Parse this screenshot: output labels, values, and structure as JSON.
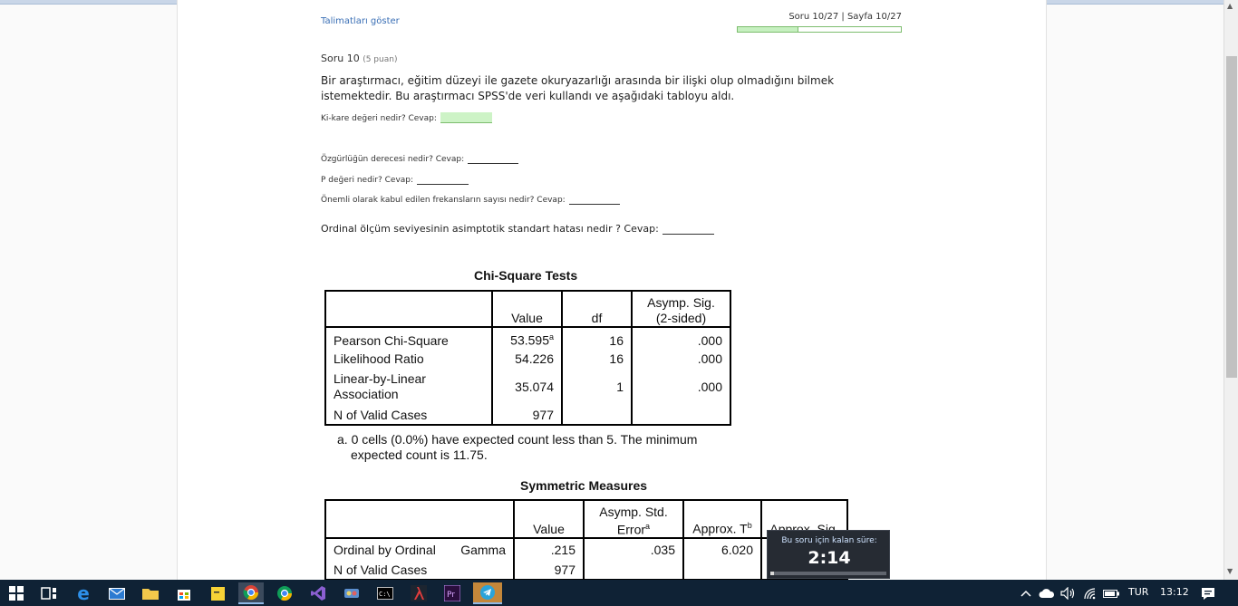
{
  "header": {
    "instructions_link": "Talimatları göster",
    "progress_label": "Soru 10/27 | Sayfa 10/27",
    "progress": 0.37
  },
  "question": {
    "title": "Soru 10",
    "points": "(5 puan)",
    "text": "Bir araştırmacı, eğitim düzeyi ile gazete okuryazarlığı arasında bir ilişki olup olmadığını bilmek istemektedir. Bu araştırmacı SPSS'de veri kullandı ve aşağıdaki tabloyu aldı.",
    "q1": "Ki-kare değeri nedir? Cevap:",
    "q2": "Özgürlüğün derecesi nedir? Cevap:",
    "q3": "P değeri nedir? Cevap:",
    "q4": "Önemli olarak kabul edilen frekansların sayısı nedir? Cevap:",
    "q5": "Ordinal ölçüm seviyesinin asimptotik standart hatası nedir ? Cevap:"
  },
  "chi_square_table": {
    "title": "Chi-Square Tests",
    "headers": [
      "",
      "Value",
      "df",
      "Asymp. Sig. (2-sided)"
    ],
    "rows": [
      {
        "label": "Pearson Chi-Square",
        "value": "53.595",
        "sup": "a",
        "df": "16",
        "sig": ".000"
      },
      {
        "label": "Likelihood Ratio",
        "value": "54.226",
        "sup": "",
        "df": "16",
        "sig": ".000"
      },
      {
        "label": "Linear-by-Linear Association",
        "value": "35.074",
        "sup": "",
        "df": "1",
        "sig": ".000"
      },
      {
        "label": "N of Valid Cases",
        "value": "977",
        "sup": "",
        "df": "",
        "sig": ""
      }
    ],
    "footnote": "a. 0 cells (0.0%) have expected count less than 5. The minimum expected count is 11.75."
  },
  "symmetric_table": {
    "title": "Symmetric Measures",
    "headers": [
      "",
      "Value",
      "Asymp. Std. Error",
      "Approx. T",
      "Approx. Sig."
    ],
    "header_sups": [
      "",
      "",
      "a",
      "b",
      ""
    ],
    "rows": [
      {
        "label": "Ordinal by Ordinal",
        "sublabel": "Gamma",
        "value": ".215",
        "error": ".035",
        "t": "6.020",
        "sig": ""
      },
      {
        "label": "N of Valid Cases",
        "sublabel": "",
        "value": "977",
        "error": "",
        "t": "",
        "sig": ""
      }
    ]
  },
  "timer": {
    "label": "Bu soru için kalan süre:",
    "value": "2:14",
    "remaining": 0.03
  },
  "taskbar": {
    "language": "TUR",
    "time": "13:12"
  },
  "colors": {
    "accent_link": "#3a6fb5",
    "answer_fill": "#cdf3c6",
    "taskbar": "#0f2235"
  }
}
